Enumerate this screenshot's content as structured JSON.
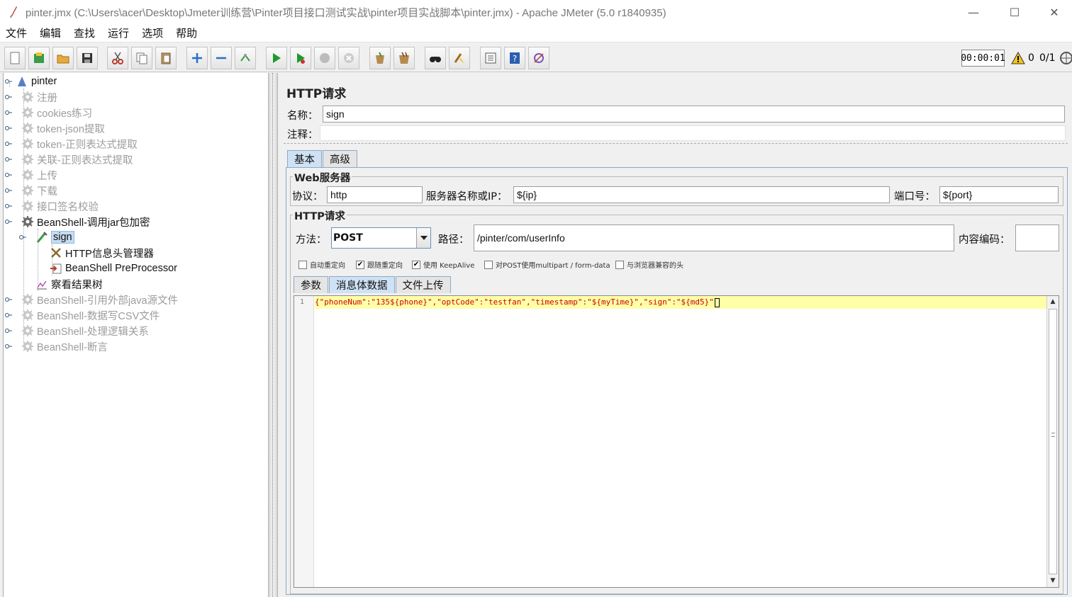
{
  "window": {
    "title": "pinter.jmx (C:\\Users\\acer\\Desktop\\Jmeter训练营\\Pinter项目接口测试实战\\pinter项目实战脚本\\pinter.jmx) - Apache JMeter (5.0 r1840935)",
    "minimize": "—",
    "maximize": "☐",
    "close": "✕"
  },
  "menu": [
    "文件",
    "编辑",
    "查找",
    "运行",
    "选项",
    "帮助"
  ],
  "toolbar": {
    "icons": [
      "new-icon",
      "templates-icon",
      "open-icon",
      "save-icon",
      "cut-icon",
      "copy-icon",
      "paste-icon",
      "expand-icon",
      "collapse-icon",
      "toggle-icon",
      "start-icon",
      "start-no-pause-icon",
      "stop-icon",
      "shutdown-icon",
      "clear-icon",
      "clear-all-icon",
      "search-icon",
      "reset-search-icon",
      "function-helper-icon",
      "help-icon",
      "log-viewer-icon"
    ],
    "timer": "00:00:01",
    "warning_count": "0",
    "threads": "0/1"
  },
  "tree": {
    "root": "pinter",
    "items": [
      {
        "label": "注册",
        "state": "disabled"
      },
      {
        "label": "cookies练习",
        "state": "disabled"
      },
      {
        "label": "token-json提取",
        "state": "disabled"
      },
      {
        "label": "token-正则表达式提取",
        "state": "disabled"
      },
      {
        "label": "关联-正则表达式提取",
        "state": "disabled"
      },
      {
        "label": "上传",
        "state": "disabled"
      },
      {
        "label": "下载",
        "state": "disabled"
      },
      {
        "label": "接口签名校验",
        "state": "disabled"
      },
      {
        "label": "BeanShell-调用jar包加密",
        "state": "enabled"
      },
      {
        "label": "sign",
        "state": "selected"
      },
      {
        "label": "HTTP信息头管理器",
        "state": "enabled"
      },
      {
        "label": "BeanShell PreProcessor",
        "state": "enabled"
      },
      {
        "label": "察看结果树",
        "state": "enabled"
      },
      {
        "label": "BeanShell-引用外部java源文件",
        "state": "disabled"
      },
      {
        "label": "BeanShell-数据写CSV文件",
        "state": "disabled"
      },
      {
        "label": "BeanShell-处理逻辑关系",
        "state": "disabled"
      },
      {
        "label": "BeanShell-断言",
        "state": "disabled"
      }
    ]
  },
  "panel": {
    "title": "HTTP请求",
    "name_label": "名称：",
    "name_value": "sign",
    "comment_label": "注释：",
    "comment_value": "",
    "tabs": [
      "基本",
      "高级"
    ],
    "web_server": {
      "group_label": "Web服务器",
      "protocol_label": "协议：",
      "protocol_value": "http",
      "server_label": "服务器名称或IP：",
      "server_value": "${ip}",
      "port_label": "端口号：",
      "port_value": "${port}"
    },
    "http_request": {
      "group_label": "HTTP请求",
      "method_label": "方法：",
      "method_value": "POST",
      "path_label": "路径：",
      "path_value": "/pinter/com/userInfo",
      "encoding_label": "内容编码：",
      "encoding_value": ""
    },
    "checkboxes": [
      {
        "label": "自动重定向",
        "checked": false
      },
      {
        "label": "跟随重定向",
        "checked": true
      },
      {
        "label": "使用 KeepAlive",
        "checked": true
      },
      {
        "label": "对POST使用multipart / form-data",
        "checked": false
      },
      {
        "label": "与浏览器兼容的头",
        "checked": false
      }
    ],
    "body_tabs": [
      "参数",
      "消息体数据",
      "文件上传"
    ],
    "editor": {
      "line_number": "1",
      "code": "{\"phoneNum\":\"135${phone}\",\"optCode\":\"testfan\",\"timestamp\":\"${myTime}\",\"sign\":\"${md5}\""
    }
  }
}
